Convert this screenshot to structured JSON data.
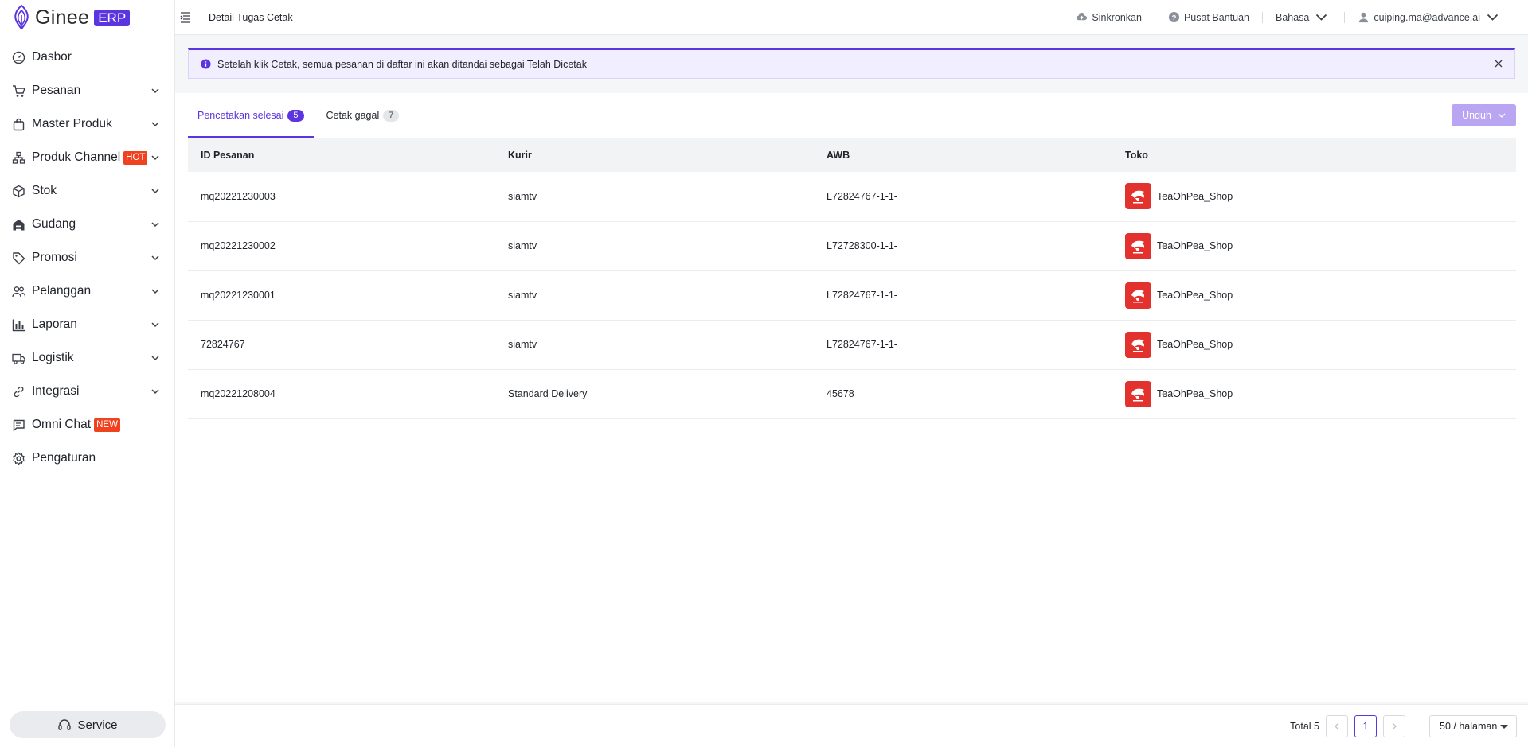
{
  "brand": {
    "name": "Ginee",
    "tag": "ERP"
  },
  "sidebar": {
    "items": [
      {
        "label": "Dasbor",
        "icon": "dashboard-icon",
        "has_chevron": false,
        "badge": ""
      },
      {
        "label": "Pesanan",
        "icon": "cart-icon",
        "has_chevron": true,
        "badge": ""
      },
      {
        "label": "Master Produk",
        "icon": "bag-icon",
        "has_chevron": true,
        "badge": ""
      },
      {
        "label": "Produk Channel",
        "icon": "channel-icon",
        "has_chevron": true,
        "badge": "HOT"
      },
      {
        "label": "Stok",
        "icon": "box-icon",
        "has_chevron": true,
        "badge": ""
      },
      {
        "label": "Gudang",
        "icon": "warehouse-icon",
        "has_chevron": true,
        "badge": ""
      },
      {
        "label": "Promosi",
        "icon": "tag-icon",
        "has_chevron": true,
        "badge": ""
      },
      {
        "label": "Pelanggan",
        "icon": "users-icon",
        "has_chevron": true,
        "badge": ""
      },
      {
        "label": "Laporan",
        "icon": "bar-chart-icon",
        "has_chevron": true,
        "badge": ""
      },
      {
        "label": "Logistik",
        "icon": "truck-icon",
        "has_chevron": true,
        "badge": ""
      },
      {
        "label": "Integrasi",
        "icon": "link-icon",
        "has_chevron": true,
        "badge": ""
      },
      {
        "label": "Omni Chat",
        "icon": "chat-icon",
        "has_chevron": false,
        "badge": "NEW"
      },
      {
        "label": "Pengaturan",
        "icon": "gear-icon",
        "has_chevron": false,
        "badge": ""
      }
    ],
    "service_label": "Service"
  },
  "header": {
    "title": "Detail Tugas Cetak",
    "sync_label": "Sinkronkan",
    "help_label": "Pusat Bantuan",
    "language_label": "Bahasa",
    "user_email": "cuiping.ma@advance.ai"
  },
  "alert": {
    "message": "Setelah klik Cetak, semua pesanan di daftar ini akan ditandai sebagai Telah Dicetak"
  },
  "tabs": [
    {
      "label": "Pencetakan selesai",
      "count": "5",
      "active": true
    },
    {
      "label": "Cetak gagal",
      "count": "7",
      "active": false
    }
  ],
  "download_label": "Unduh",
  "table": {
    "columns": [
      "ID Pesanan",
      "Kurir",
      "AWB",
      "Toko"
    ],
    "rows": [
      {
        "order_id": "mq20221230003",
        "courier": "siamtv",
        "awb": "L72824767-1-1-",
        "shop": "TeaOhPea_Shop"
      },
      {
        "order_id": "mq20221230002",
        "courier": "siamtv",
        "awb": "L72728300-1-1-",
        "shop": "TeaOhPea_Shop"
      },
      {
        "order_id": "mq20221230001",
        "courier": "siamtv",
        "awb": "L72824767-1-1-",
        "shop": "TeaOhPea_Shop"
      },
      {
        "order_id": "72824767",
        "courier": "siamtv",
        "awb": "L72824767-1-1-",
        "shop": "TeaOhPea_Shop"
      },
      {
        "order_id": "mq20221208004",
        "courier": "Standard Delivery",
        "awb": "45678",
        "shop": "TeaOhPea_Shop"
      }
    ]
  },
  "pagination": {
    "total_label": "Total 5",
    "current_page": "1",
    "page_size_label": "50 / halaman"
  },
  "colors": {
    "accent": "#5b35e0",
    "badge_red": "#f0421f",
    "shop_logo": "#e3312d"
  }
}
